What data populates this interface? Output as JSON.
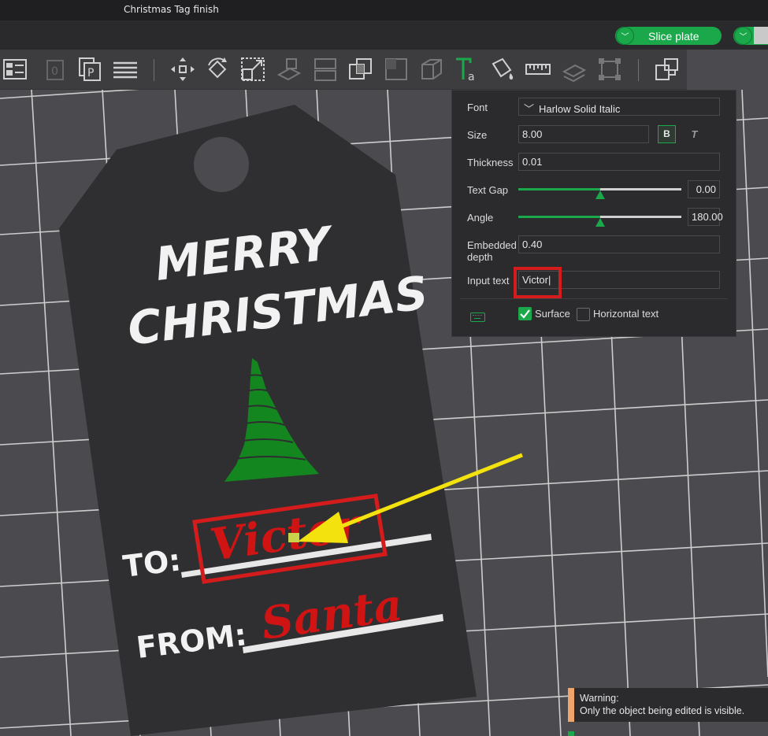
{
  "window": {
    "title": "Christmas Tag finish"
  },
  "topbar": {
    "slice_label": "Slice plate",
    "dropdown_glyph": "﹀"
  },
  "toolbar": {
    "icons": [
      "layout-icon",
      "plate-icon",
      "text-p-icon",
      "arrange-icon",
      "move-icon",
      "rotate-icon",
      "scale-icon",
      "lay-on-face-icon",
      "split-icon",
      "boolean-icon",
      "corner-icon",
      "cube-icon",
      "text-tool-icon",
      "paint-icon",
      "measure-icon",
      "assembly-icon",
      "seam-icon",
      "variable-layer-icon"
    ]
  },
  "panel": {
    "font_label": "Font",
    "font_value": "Harlow Solid Italic",
    "size_label": "Size",
    "size_value": "8.00",
    "bold_label": "B",
    "italic_label": "T",
    "thickness_label": "Thickness",
    "thickness_value": "0.01",
    "text_gap_label": "Text Gap",
    "text_gap_value": "0.00",
    "text_gap_fraction": 0.5,
    "angle_label": "Angle",
    "angle_value": "180.00",
    "angle_fraction": 0.5,
    "embedded_label_1": "Embedded",
    "embedded_label_2": "depth",
    "embedded_value": "0.40",
    "input_text_label": "Input text",
    "input_text_value": "Victor",
    "surface_label": "Surface",
    "surface_checked": true,
    "horizontal_label": "Horizontal text",
    "horizontal_checked": false,
    "accent_color": "#1aa84b",
    "highlight_color": "#d41c1c"
  },
  "tag": {
    "line1": "MERRY",
    "line2": "CHRISTMAS",
    "to_label": "TO:",
    "to_name": "Victor",
    "from_label": "FROM:",
    "from_name": "Santa",
    "tree_color": "#14861f",
    "name_color": "#d01414"
  },
  "warning": {
    "line1": "Warning:",
    "line2": "Only the object being edited is visible."
  }
}
